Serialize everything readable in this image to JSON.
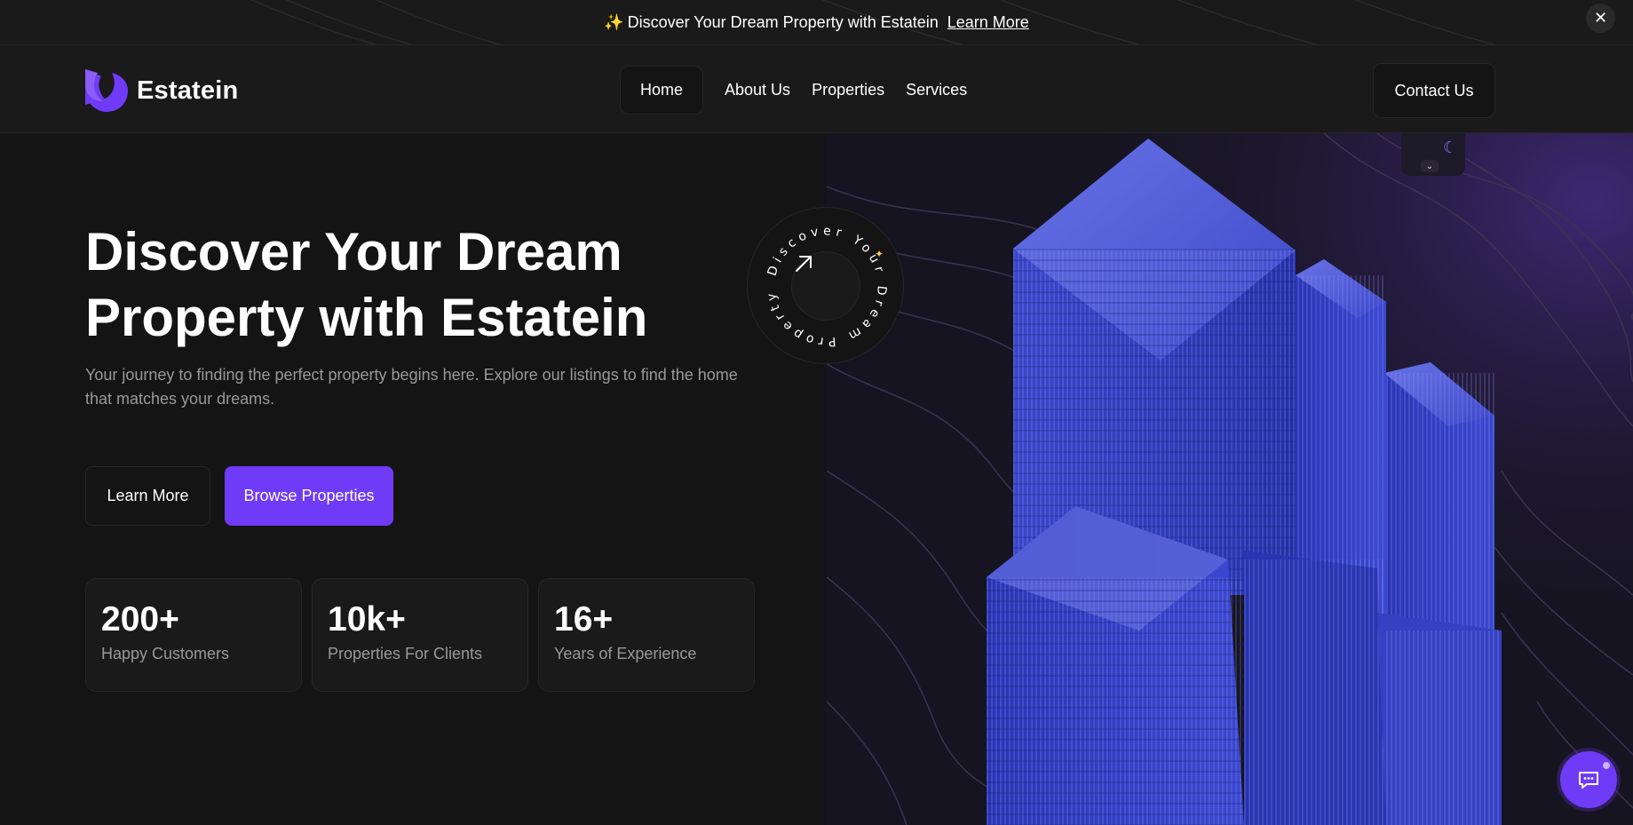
{
  "banner": {
    "spark_icon": "sparkles-icon",
    "text": "Discover Your Dream Property with Estatein",
    "link": "Learn More",
    "close_icon": "close-icon"
  },
  "header": {
    "logo_name": "Estatein",
    "nav": [
      {
        "label": "Home",
        "active": true
      },
      {
        "label": "About Us",
        "active": false
      },
      {
        "label": "Properties",
        "active": false
      },
      {
        "label": "Services",
        "active": false
      }
    ],
    "contact_label": "Contact Us"
  },
  "hero": {
    "title_line1": "Discover Your Dream",
    "title_line2": "Property with Estatein",
    "subtitle": "Your journey to finding the perfect property begins here. Explore our listings to find the home that matches your dreams.",
    "learn_more": "Learn More",
    "browse": "Browse Properties",
    "badge_text": "Discover Your Dream Property",
    "stats": [
      {
        "value": "200+",
        "label": "Happy Customers"
      },
      {
        "value": "10k+",
        "label": "Properties For Clients"
      },
      {
        "value": "16+",
        "label": "Years of Experience"
      }
    ]
  },
  "colors": {
    "accent": "#703bf7",
    "background": "#141414",
    "surface": "#1a1a1a",
    "border": "#262626",
    "muted_text": "#999999"
  },
  "icons": {
    "theme_toggle": "moon-icon",
    "theme_chevron": "chevron-down-icon",
    "badge_arrow": "arrow-up-right-icon",
    "chat": "chat-bubble-icon"
  }
}
